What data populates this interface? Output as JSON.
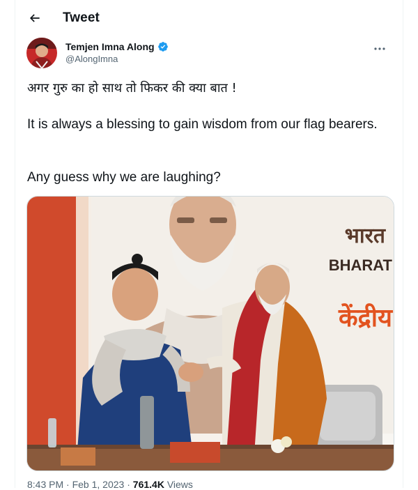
{
  "header": {
    "title": "Tweet"
  },
  "author": {
    "display_name": "Temjen Imna Along",
    "handle": "@AlongImna",
    "verified": true
  },
  "tweet": {
    "line_hindi": "अगर गुरु का हो साथ तो फिकर की क्या बात !",
    "line_english": "It is always a blessing to gain wisdom from our flag bearers.",
    "line_question": "Any guess why we are laughing?"
  },
  "media": {
    "banner_text_hindi": "भारत",
    "banner_text_english": "BHARAT",
    "banner_text_hindi_2": "केंद्रीय"
  },
  "meta": {
    "time": "8:43 PM",
    "separator": "·",
    "date": "Feb 1, 2023",
    "views_count": "761.4K",
    "views_label": "Views"
  },
  "colors": {
    "verified": "#1d9bf0",
    "text_primary": "#0f1419",
    "text_secondary": "#536471",
    "border": "#cfd9de"
  },
  "icons": {
    "back": "back-arrow-icon",
    "verified": "verified-badge-icon",
    "more": "more-options-icon"
  }
}
